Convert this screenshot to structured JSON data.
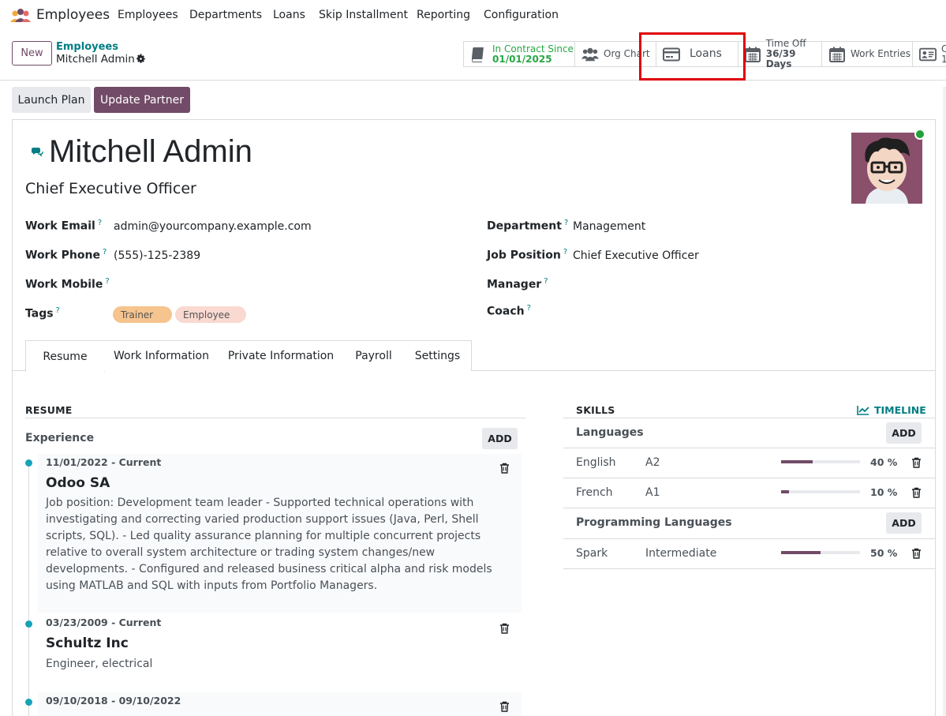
{
  "app": {
    "title": "Employees",
    "logo_icon": "employees-app-icon"
  },
  "menu": [
    "Employees",
    "Departments",
    "Loans",
    "Skip Installment",
    "Reporting",
    "Configuration"
  ],
  "control_panel": {
    "new_label": "New",
    "breadcrumb_parent": "Employees",
    "breadcrumb_current": "Mitchell Admin"
  },
  "smart_buttons": {
    "contract": {
      "line1": "In Contract Since",
      "line2": "01/01/2025"
    },
    "org_chart": {
      "label": "Org Chart"
    },
    "loans": {
      "label": "Loans"
    },
    "time_off": {
      "line1": "Time Off",
      "line2": "36/39 Days"
    },
    "work_entries": {
      "label": "Work Entries"
    },
    "contracts_partial": {
      "line1": "C",
      "line2": "1"
    }
  },
  "actions": {
    "launch_plan": "Launch Plan",
    "update_partner": "Update Partner"
  },
  "employee": {
    "name": "Mitchell Admin",
    "job_title": "Chief Executive Officer",
    "presence_color": "#20a13a"
  },
  "fields": {
    "work_email": {
      "label": "Work Email",
      "value": "admin@yourcompany.example.com"
    },
    "work_phone": {
      "label": "Work Phone",
      "value": "(555)-125-2389"
    },
    "work_mobile": {
      "label": "Work Mobile",
      "value": ""
    },
    "tags": {
      "label": "Tags",
      "values": [
        "Trainer",
        "Employee"
      ]
    },
    "department": {
      "label": "Department",
      "value": "Management"
    },
    "job_position": {
      "label": "Job Position",
      "value": "Chief Executive Officer"
    },
    "manager": {
      "label": "Manager",
      "value": ""
    },
    "coach": {
      "label": "Coach",
      "value": ""
    },
    "help_marker": "?"
  },
  "tabs": [
    "Resume",
    "Work Information",
    "Private Information",
    "Payroll",
    "Settings"
  ],
  "resume": {
    "heading": "RESUME",
    "experience_label": "Experience",
    "add_label": "ADD",
    "items": [
      {
        "date": "11/01/2022 - Current",
        "title": "Odoo SA",
        "description": "Job position: Development team leader - Supported technical operations with investigating and correcting varied production support issues (Java, Perl, Shell scripts, SQL). - Led quality assurance planning for multiple concurrent projects relative to overall system architecture or trading system changes/new developments. - Configured and released business critical alpha and risk models using MATLAB and SQL with inputs from Portfolio Managers."
      },
      {
        "date": "03/23/2009 - Current",
        "title": "Schultz Inc",
        "description": "Engineer, electrical"
      },
      {
        "date": "09/10/2018 - 09/10/2022",
        "title": "",
        "description": ""
      }
    ]
  },
  "skills": {
    "heading": "SKILLS",
    "timeline_label": "TIMELINE",
    "add_label": "ADD",
    "categories": [
      {
        "name": "Languages",
        "items": [
          {
            "name": "English",
            "level": "A2",
            "progress": 40,
            "progress_label": "40 %"
          },
          {
            "name": "French",
            "level": "A1",
            "progress": 10,
            "progress_label": "10 %"
          }
        ]
      },
      {
        "name": "Programming Languages",
        "items": [
          {
            "name": "Spark",
            "level": "Intermediate",
            "progress": 50,
            "progress_label": "50 %"
          }
        ]
      }
    ]
  },
  "colors": {
    "brand": "#714b67",
    "teal": "#017e84",
    "dot": "#17a2b8",
    "highlight": "#e00000"
  }
}
